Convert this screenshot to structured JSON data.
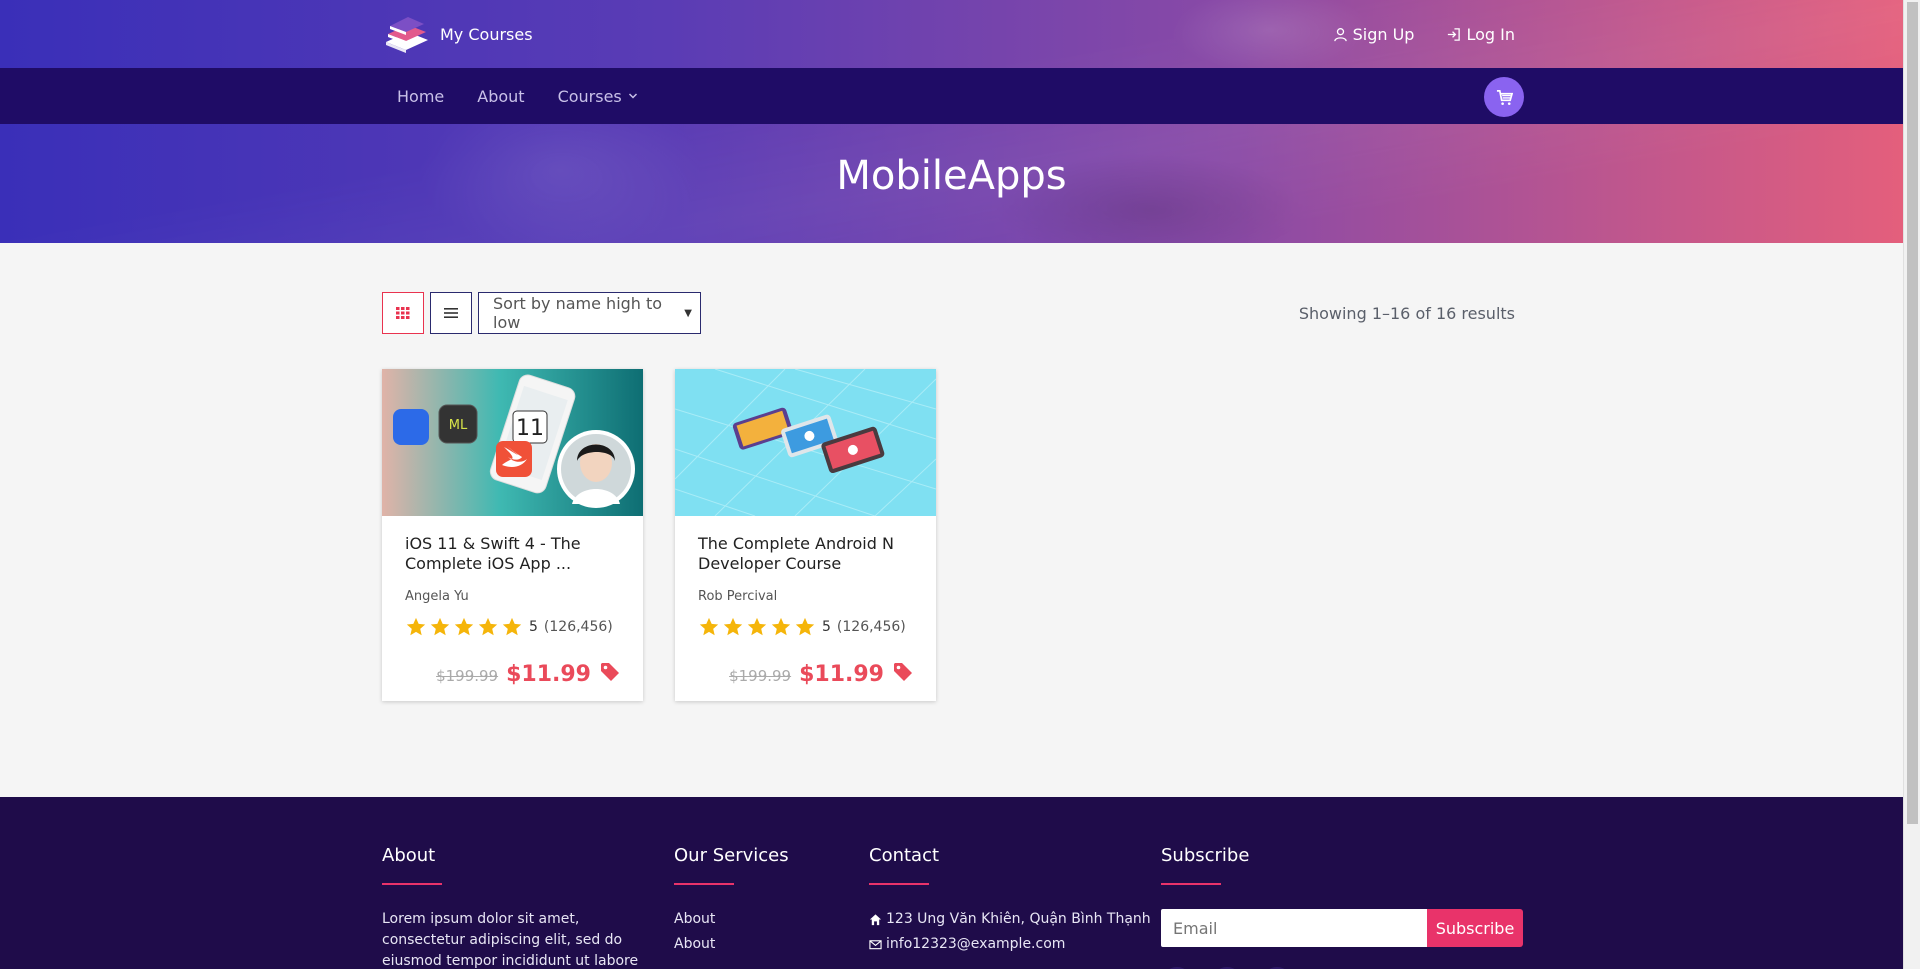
{
  "brand": {
    "name": "My Courses",
    "logo_icon": "books-stack-icon"
  },
  "auth": {
    "signup_label": "Sign Up",
    "login_label": "Log In"
  },
  "nav": {
    "items": [
      {
        "label": "Home"
      },
      {
        "label": "About"
      },
      {
        "label": "Courses"
      }
    ],
    "cart_icon": "cart-icon"
  },
  "page": {
    "title": "MobileApps"
  },
  "toolbar": {
    "sort_selected": "Sort by name high to low",
    "result_count": "Showing 1–16 of 16 results",
    "active_view": "grid"
  },
  "courses": [
    {
      "title": "iOS 11 & Swift 4 - The Complete iOS App ...",
      "author": "Angela Yu",
      "rating": "5",
      "rating_count": "(126,456)",
      "old_price": "$199.99",
      "price": "$11.99"
    },
    {
      "title": "The Complete Android N Developer Course",
      "author": "Rob Percival",
      "rating": "5",
      "rating_count": "(126,456)",
      "old_price": "$199.99",
      "price": "$11.99"
    }
  ],
  "footer": {
    "about": {
      "heading": "About",
      "text": "Lorem ipsum dolor sit amet, consectetur adipiscing elit, sed do eiusmod tempor incididunt ut labore et dolore magna"
    },
    "services": {
      "heading": "Our Services",
      "links": [
        "About",
        "About"
      ]
    },
    "contact": {
      "heading": "Contact",
      "address": "123 Ung Văn Khiên, Quận Bình Thạnh",
      "email": "info12323@example.com"
    },
    "subscribe": {
      "heading": "Subscribe",
      "placeholder": "Email",
      "button": "Subscribe"
    }
  },
  "colors": {
    "accent": "#e9336a",
    "nav_bg": "#1f0c66",
    "footer_bg": "#1f0c4a",
    "price": "#ea4a5a",
    "star": "#f5b50a"
  }
}
